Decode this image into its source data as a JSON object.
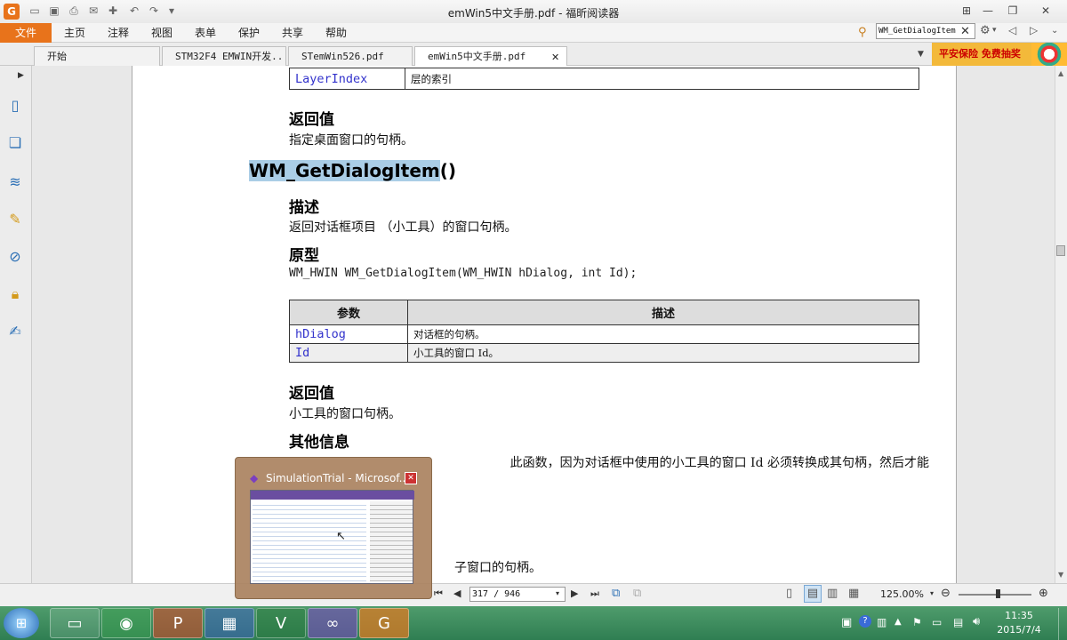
{
  "window": {
    "title": "emWin5中文手册.pdf - 福昕阅读器"
  },
  "quick_access": [
    "save-icon",
    "open-folder-icon",
    "print-icon",
    "email-icon",
    "new-icon",
    "undo-icon",
    "redo-icon",
    "customize-icon"
  ],
  "menu": {
    "file": "文件",
    "items": [
      "主页",
      "注释",
      "视图",
      "表单",
      "保护",
      "共享",
      "帮助"
    ]
  },
  "search": {
    "value": "WM_GetDialogItem"
  },
  "tabs": [
    {
      "label": "开始",
      "active": false
    },
    {
      "label": "STM32F4 EMWIN开发...",
      "active": false
    },
    {
      "label": "STemWin526.pdf",
      "active": false
    },
    {
      "label": "emWin5中文手册.pdf",
      "active": true,
      "close": "✕"
    }
  ],
  "ad": {
    "text": "平安保险 免费抽奖"
  },
  "doc": {
    "top_table": {
      "param": "LayerIndex",
      "desc": "层的索引"
    },
    "ret1": {
      "heading": "返回值",
      "text": "指定桌面窗口的句柄。"
    },
    "func": {
      "name": "WM_GetDialogItem",
      "suffix": "()"
    },
    "desc": {
      "heading": "描述",
      "text": "返回对话框项目 （小工具）的窗口句柄。"
    },
    "proto": {
      "heading": "原型",
      "code": "WM_HWIN WM_GetDialogItem(WM_HWIN hDialog, int Id);"
    },
    "params": {
      "headers": [
        "参数",
        "描述"
      ],
      "rows": [
        [
          "hDialog",
          "对话框的句柄。"
        ],
        [
          "Id",
          "小工具的窗口 Id。"
        ]
      ]
    },
    "ret2": {
      "heading": "返回值",
      "text": "小工具的窗口句柄。"
    },
    "info": {
      "heading": "其他信息",
      "text": "此函数，因为对话框中使用的小工具的窗口 Id 必须转换成其句柄，然后才能",
      "text2": "子窗口的句柄。"
    }
  },
  "preview": {
    "title": "SimulationTrial - Microsof..."
  },
  "status": {
    "page": "317 / 946",
    "zoom": "125.00%"
  },
  "taskbar": {
    "time": "11:35",
    "date": "2015/7/4"
  }
}
